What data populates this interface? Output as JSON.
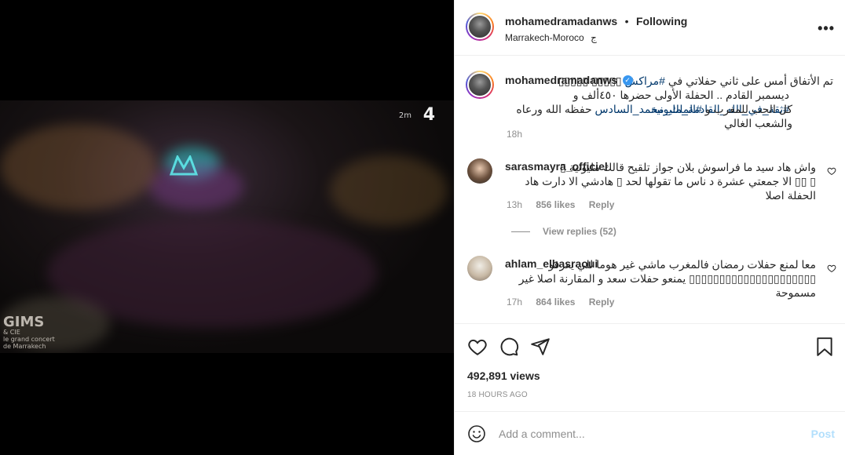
{
  "post": {
    "author": "mohamedramadanws",
    "separator": "•",
    "follow_status": "Following",
    "location": "Marrakech-Moroco",
    "location_flag": "ج",
    "more_icon": "more-horizontal-icon"
  },
  "caption": {
    "username": "mohamedramadanws",
    "line1_pre": "تم الأتفاق أمس على ثاني حفلاتي في ",
    "line1_tag": "#مراكش",
    "line1_post": " ▯▯▯▯▯ ▯▯▯▯▯",
    "line2_pre": "ديسمبر القادم .. الحفلة الأولى حضرها ٤٥٠ألف و ",
    "line2_tag": "#ثقة_في_الله_القادمة_مليونية",
    "line3_pre": "كل الحب للمغرب و ",
    "line3_tag": "#الملك_محمد_السادس",
    "line3_post": " حفظه الله ورعاه والشعب الغالي",
    "time": "18h"
  },
  "comments": [
    {
      "username": "sarasmayra_officiel",
      "line1": "واش هاد سيد ما فراسوش بلان جواز تلقيح قالك مليونية ▯",
      "line2": "▯ ▯▯ الا جمعتي عشرة د ناس ما تقولها لحد ▯ هادشي الا دارت هاد الحفلة اصلا",
      "time": "13h",
      "likes": "856 likes",
      "reply": "Reply",
      "view_replies": "View replies (52)"
    },
    {
      "username": "ahlam_elbasraoui",
      "line1": "معا لمنع حفلات رمضان فالمغرب ماشي غير هوما للي يعرفو",
      "line2": "▯▯▯▯▯▯▯▯▯▯▯▯▯▯▯▯▯▯▯▯▯ يمنعو حفلات سعد و المقارنة اصلا غير مسموحة",
      "time": "17h",
      "likes": "864 likes",
      "reply": "Reply"
    }
  ],
  "stats": {
    "views": "492,891 views",
    "posted": "18 HOURS AGO"
  },
  "composer": {
    "placeholder": "Add a comment...",
    "post_label": "Post"
  },
  "video": {
    "channel_logo": "4",
    "channel_sub": "2m",
    "overlay_title": "GIMS",
    "overlay_sub1": "& CIE",
    "overlay_sub2": "le grand concert",
    "overlay_sub3": "de Marrakech"
  }
}
